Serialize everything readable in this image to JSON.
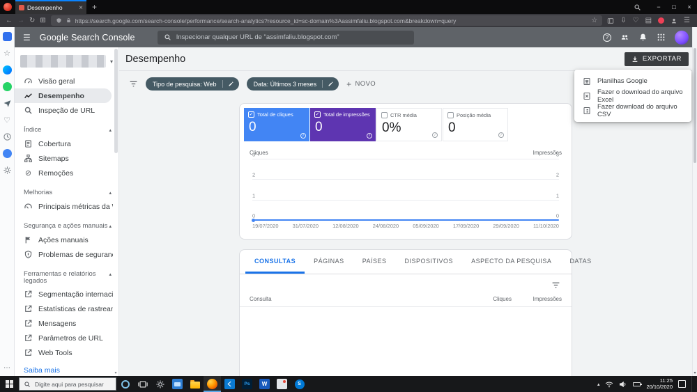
{
  "browser": {
    "tab": {
      "title": "Desempenho"
    },
    "url": "https://search.google.com/search-console/performance/search-analytics?resource_id=sc-domain%3Aassimfaliu.blogspot.com&breakdown=query"
  },
  "icons": {
    "back": "←",
    "forward": "→",
    "reload": "↻",
    "star": "☆",
    "heart": "♡",
    "library": "▤",
    "download_arrow": "⇩",
    "menu": "☰",
    "close": "×",
    "minimize": "−",
    "maximize": "□",
    "plus": "+",
    "check": "✓",
    "chevron_down": "▾",
    "chevron_up": "▴",
    "ext_grid": "⊞",
    "block": "⊘",
    "more": "⋯",
    "help": "?",
    "info": "i"
  },
  "colors": {
    "clicks_blue": "#4285f4",
    "impressions_purple": "#5e35b1",
    "link_blue": "#1a73e8",
    "chip_slate": "#455a64"
  },
  "gsc": {
    "header": {
      "title": "Google Search Console",
      "search_placeholder": "Inspecionar qualquer URL de \"assimfaliu.blogspot.com\""
    },
    "sidebar": {
      "items_top": [
        {
          "label": "Visão geral"
        },
        {
          "label": "Desempenho",
          "active": true
        },
        {
          "label": "Inspeção de URL"
        }
      ],
      "sections": [
        {
          "title": "Índice",
          "items": [
            "Cobertura",
            "Sitemaps",
            "Remoções"
          ]
        },
        {
          "title": "Melhorias",
          "items": [
            "Principais métricas da Web"
          ]
        },
        {
          "title": "Segurança e ações manuais",
          "items": [
            "Ações manuais",
            "Problemas de segurança"
          ]
        },
        {
          "title": "Ferramentas e relatórios legados",
          "items": [
            "Segmentação internacional",
            "Estatísticas de rastreamento",
            "Mensagens",
            "Parâmetros de URL",
            "Web Tools"
          ]
        }
      ],
      "footer_link": "Saiba mais"
    },
    "page": {
      "title": "Desempenho",
      "export_button": "EXPORTAR",
      "export_menu": [
        {
          "label": "Planilhas Google"
        },
        {
          "label": "Fazer o download do arquivo Excel"
        },
        {
          "label": "Fazer download do arquivo CSV"
        }
      ],
      "filters": {
        "chips": [
          {
            "label": "Tipo de pesquisa: Web"
          },
          {
            "label": "Data: Últimos 3 meses"
          }
        ],
        "new_button": "NOVO"
      },
      "metrics": [
        {
          "label": "Total de cliques",
          "value": "0",
          "selected": true
        },
        {
          "label": "Total de impressões",
          "value": "0",
          "selected": true
        },
        {
          "label": "CTR média",
          "value": "0%",
          "selected": false
        },
        {
          "label": "Posição média",
          "value": "0",
          "selected": false
        }
      ],
      "tabs": [
        {
          "label": "CONSULTAS",
          "active": true
        },
        {
          "label": "PÁGINAS"
        },
        {
          "label": "PAÍSES"
        },
        {
          "label": "DISPOSITIVOS"
        },
        {
          "label": "ASPECTO DA PESQUISA"
        },
        {
          "label": "DATAS"
        }
      ],
      "table": {
        "headers": [
          "Consulta",
          "Cliques",
          "Impressões"
        ],
        "rows": []
      }
    }
  },
  "chart_data": {
    "type": "line",
    "title": "",
    "x": [
      "19/07/2020",
      "31/07/2020",
      "12/08/2020",
      "24/08/2020",
      "05/09/2020",
      "17/09/2020",
      "29/09/2020",
      "11/10/2020"
    ],
    "series": [
      {
        "name": "Cliques",
        "values": [
          0,
          0,
          0,
          0,
          0,
          0,
          0,
          0
        ],
        "color": "#4285f4"
      },
      {
        "name": "Impressões",
        "values": [
          0,
          0,
          0,
          0,
          0,
          0,
          0,
          0
        ],
        "color": "#5e35b1"
      }
    ],
    "left_axis": {
      "label": "Cliques",
      "ticks": [
        "3",
        "2",
        "1",
        "0"
      ]
    },
    "right_axis": {
      "label": "Impressões",
      "ticks": [
        "3",
        "2",
        "1",
        "0"
      ]
    },
    "ylim": [
      0,
      3
    ],
    "grid": true,
    "legend_position": "none"
  },
  "taskbar": {
    "search_placeholder": "Digite aqui para pesquisar",
    "time": "11:25",
    "date": "20/10/2020"
  }
}
